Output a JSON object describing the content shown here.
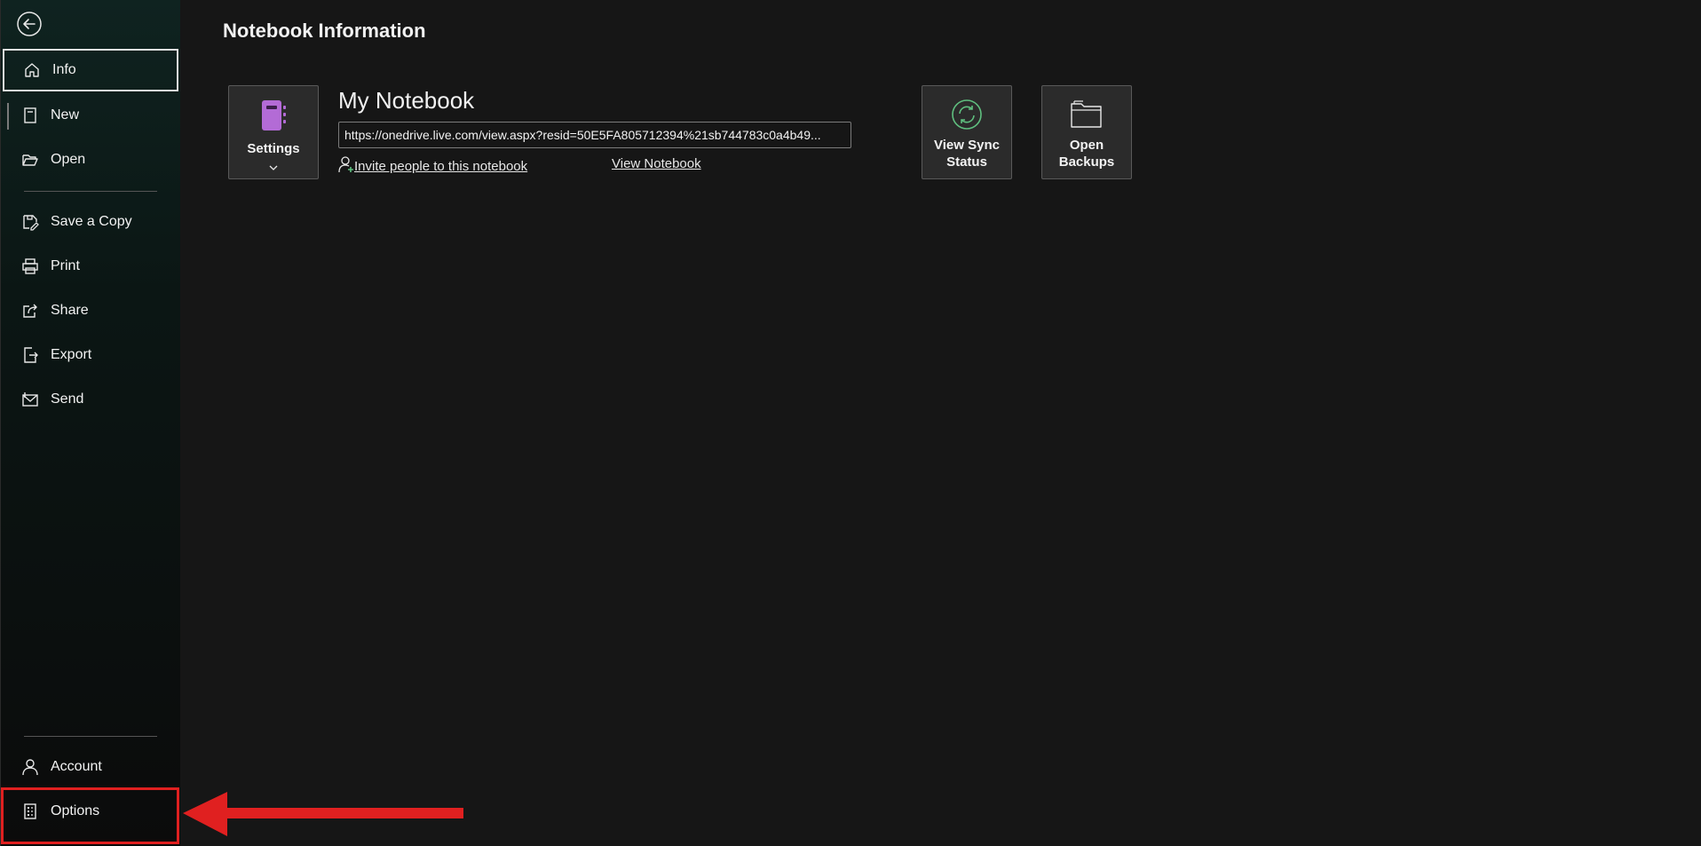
{
  "sidebar": {
    "back_icon": "back-arrow-icon",
    "items": [
      {
        "label": "Info",
        "icon": "home-icon"
      },
      {
        "label": "New",
        "icon": "new-notebook-icon"
      },
      {
        "label": "Open",
        "icon": "folder-open-icon"
      },
      {
        "label": "Save a Copy",
        "icon": "save-copy-icon"
      },
      {
        "label": "Print",
        "icon": "printer-icon"
      },
      {
        "label": "Share",
        "icon": "share-icon"
      },
      {
        "label": "Export",
        "icon": "export-icon"
      },
      {
        "label": "Send",
        "icon": "send-icon"
      },
      {
        "label": "Account",
        "icon": "person-icon"
      },
      {
        "label": "Options",
        "icon": "options-icon"
      }
    ],
    "selected": "Info",
    "highlighted": "Options"
  },
  "main": {
    "title": "Notebook Information",
    "notebook": {
      "name": "My Notebook",
      "url": "https://onedrive.live.com/view.aspx?resid=50E5FA805712394%21sb744783c0a4b49...",
      "invite_label": "Invite people to this notebook",
      "view_label": "View Notebook"
    },
    "tiles": {
      "settings": {
        "label": "Settings",
        "icon": "notebook-icon"
      },
      "sync": {
        "line1": "View Sync",
        "line2": "Status",
        "icon": "sync-icon"
      },
      "backups": {
        "line1": "Open",
        "line2": "Backups",
        "icon": "folder-icon"
      }
    }
  },
  "colors": {
    "background": "#161616",
    "notebook_icon": "#b36bd6",
    "sync_icon": "#5fbf7f",
    "annotation": "#e02020"
  }
}
